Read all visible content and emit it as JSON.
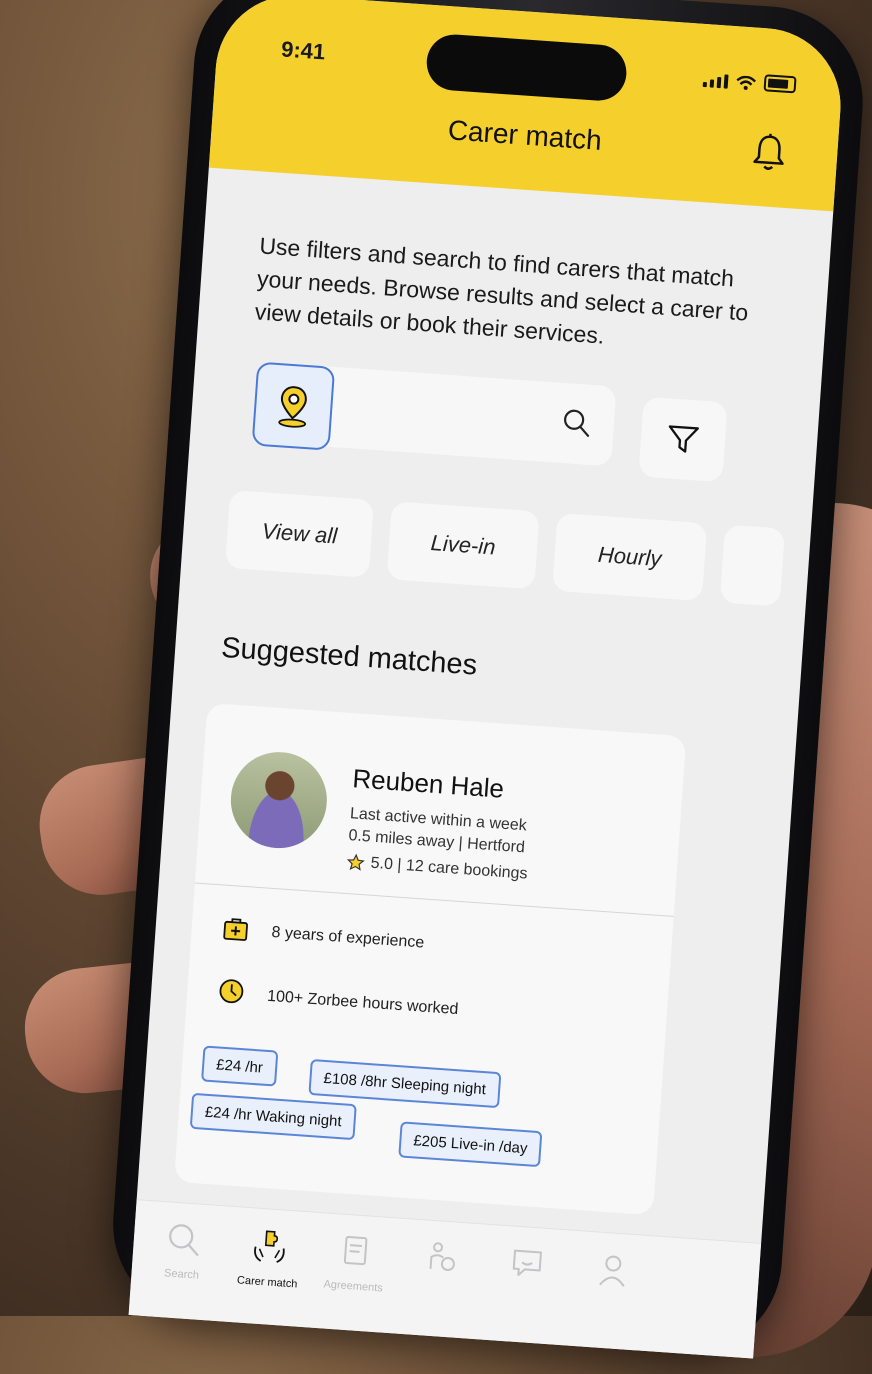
{
  "status": {
    "time": "9:41"
  },
  "header": {
    "title": "Carer match"
  },
  "intro": "Use filters and search to find carers that match your needs. Browse results and select a carer to view details or book their services.",
  "search": {
    "placeholder": ""
  },
  "chips": [
    "View all",
    "Live-in",
    "Hourly"
  ],
  "section_title": "Suggested matches",
  "carer": {
    "name": "Reuben Hale",
    "active": "Last active within a week",
    "distance": "0.5 miles away | Hertford",
    "rating_line": "5.0 | 12 care bookings",
    "features": [
      "8 years of experience",
      "100+ Zorbee hours worked"
    ],
    "prices": [
      "£24 /hr",
      "£108 /8hr Sleeping night",
      "£24 /hr  Waking night",
      "£205 Live-in /day"
    ]
  },
  "nav": [
    {
      "label": "Search",
      "icon": "search-icon"
    },
    {
      "label": "Carer match",
      "icon": "puzzle-hands-icon"
    },
    {
      "label": "Agreements",
      "icon": "agreement-icon"
    },
    {
      "label": "",
      "icon": "care-icon"
    },
    {
      "label": "",
      "icon": "chat-icon"
    },
    {
      "label": "",
      "icon": "profile-icon"
    }
  ],
  "colors": {
    "accent": "#f5cf2c",
    "chip_border": "#5b86d8",
    "background": "#eeeeef"
  }
}
